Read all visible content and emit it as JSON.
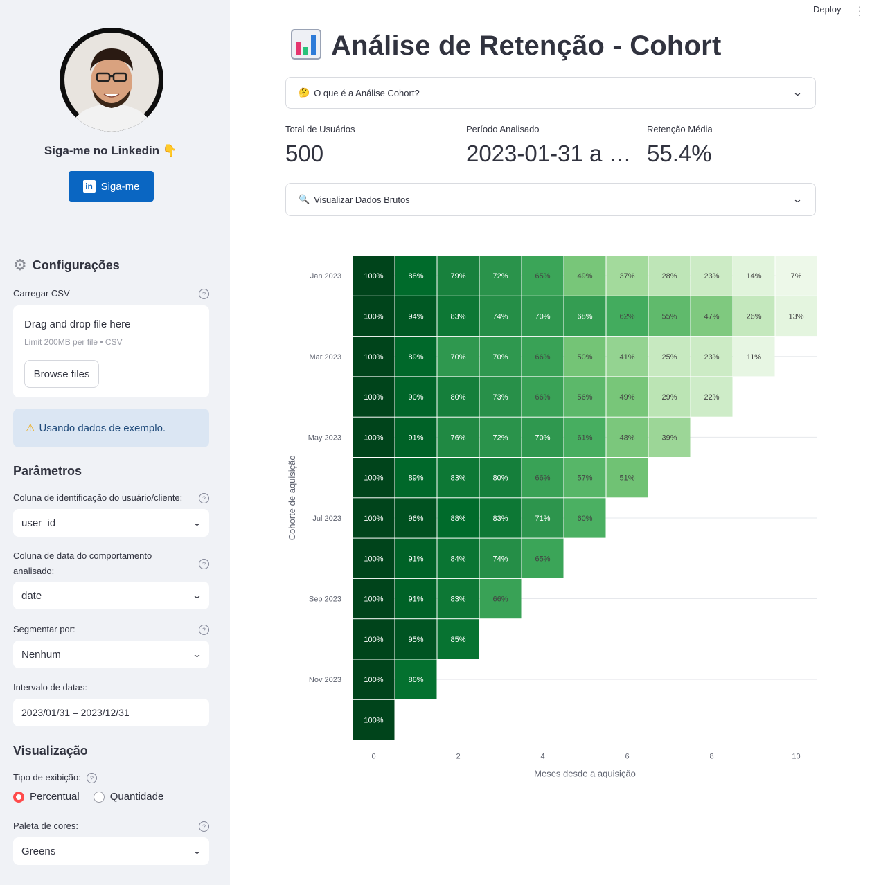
{
  "app": {
    "deploy_label": "Deploy"
  },
  "sidebar": {
    "follow_text": "Siga-me no Linkedin 👇",
    "linkedin_button": "Siga-me",
    "config_title": "Configurações",
    "upload_label": "Carregar CSV",
    "drop_text": "Drag and drop file here",
    "limit_text": "Limit 200MB per file • CSV",
    "browse_label": "Browse files",
    "info_message": "Usando dados de exemplo.",
    "params_title": "Parâmetros",
    "user_col_label": "Coluna de identificação do usuário/cliente:",
    "user_col_value": "user_id",
    "date_col_label": "Coluna de data do comportamento analisado:",
    "date_col_value": "date",
    "segment_label": "Segmentar por:",
    "segment_value": "Nenhum",
    "date_range_label": "Intervalo de datas:",
    "date_range_value": "2023/01/31 – 2023/12/31",
    "viz_title": "Visualização",
    "display_type_label": "Tipo de exibição:",
    "radio_percent": "Percentual",
    "radio_quantity": "Quantidade",
    "palette_label": "Paleta de cores:",
    "palette_value": "Greens"
  },
  "main": {
    "title": "Análise de Retenção - Cohort",
    "expander_what": "O que é a Análise Cohort?",
    "expander_raw": "Visualizar Dados Brutos",
    "metrics": [
      {
        "label": "Total de Usuários",
        "value": "500"
      },
      {
        "label": "Período Analisado",
        "value": "2023-01-31 a …"
      },
      {
        "label": "Retenção Média",
        "value": "55.4%"
      }
    ]
  },
  "chart_data": {
    "type": "heatmap",
    "xlabel": "Meses desde a aquisição",
    "ylabel": "Cohorte de aquisição",
    "x_ticks": [
      "0",
      "2",
      "4",
      "6",
      "8",
      "10"
    ],
    "y_ticks": [
      "Jan 2023",
      "Mar 2023",
      "May 2023",
      "Jul 2023",
      "Sep 2023",
      "Nov 2023"
    ],
    "colorscale": "Greens",
    "rows": [
      [
        100,
        88,
        79,
        72,
        65,
        49,
        37,
        28,
        23,
        14,
        7
      ],
      [
        100,
        94,
        83,
        74,
        70,
        68,
        62,
        55,
        47,
        26,
        13
      ],
      [
        100,
        89,
        70,
        70,
        66,
        50,
        41,
        25,
        23,
        11
      ],
      [
        100,
        90,
        80,
        73,
        66,
        56,
        49,
        29,
        22
      ],
      [
        100,
        91,
        76,
        72,
        70,
        61,
        48,
        39
      ],
      [
        100,
        89,
        83,
        80,
        66,
        57,
        51
      ],
      [
        100,
        96,
        88,
        83,
        71,
        60
      ],
      [
        100,
        91,
        84,
        74,
        65
      ],
      [
        100,
        91,
        83,
        66
      ],
      [
        100,
        95,
        85
      ],
      [
        100,
        86
      ],
      [
        100
      ]
    ]
  }
}
